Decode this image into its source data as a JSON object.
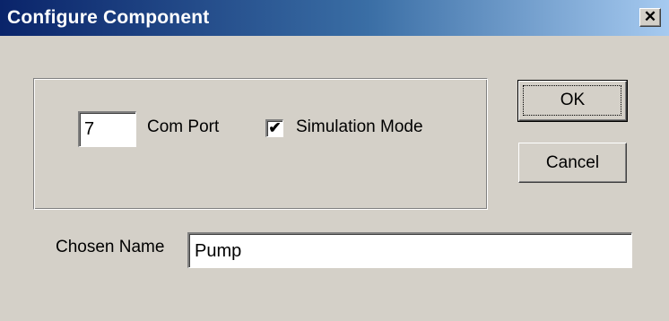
{
  "window": {
    "title": "Configure Component",
    "close_glyph": "✕"
  },
  "settings": {
    "com_port_value": "7",
    "com_port_label": "Com Port",
    "simulation_checked": true,
    "simulation_check_glyph": "✔",
    "simulation_label": "Simulation Mode"
  },
  "buttons": {
    "ok_label": "OK",
    "cancel_label": "Cancel"
  },
  "name": {
    "label": "Chosen Name",
    "value": "Pump"
  },
  "colors": {
    "title_gradient_start": "#0a246a",
    "title_gradient_end": "#a6caf0",
    "dialog_face": "#d4d0c8"
  },
  "icons": {
    "close": "close-icon",
    "check": "checkmark-icon"
  }
}
